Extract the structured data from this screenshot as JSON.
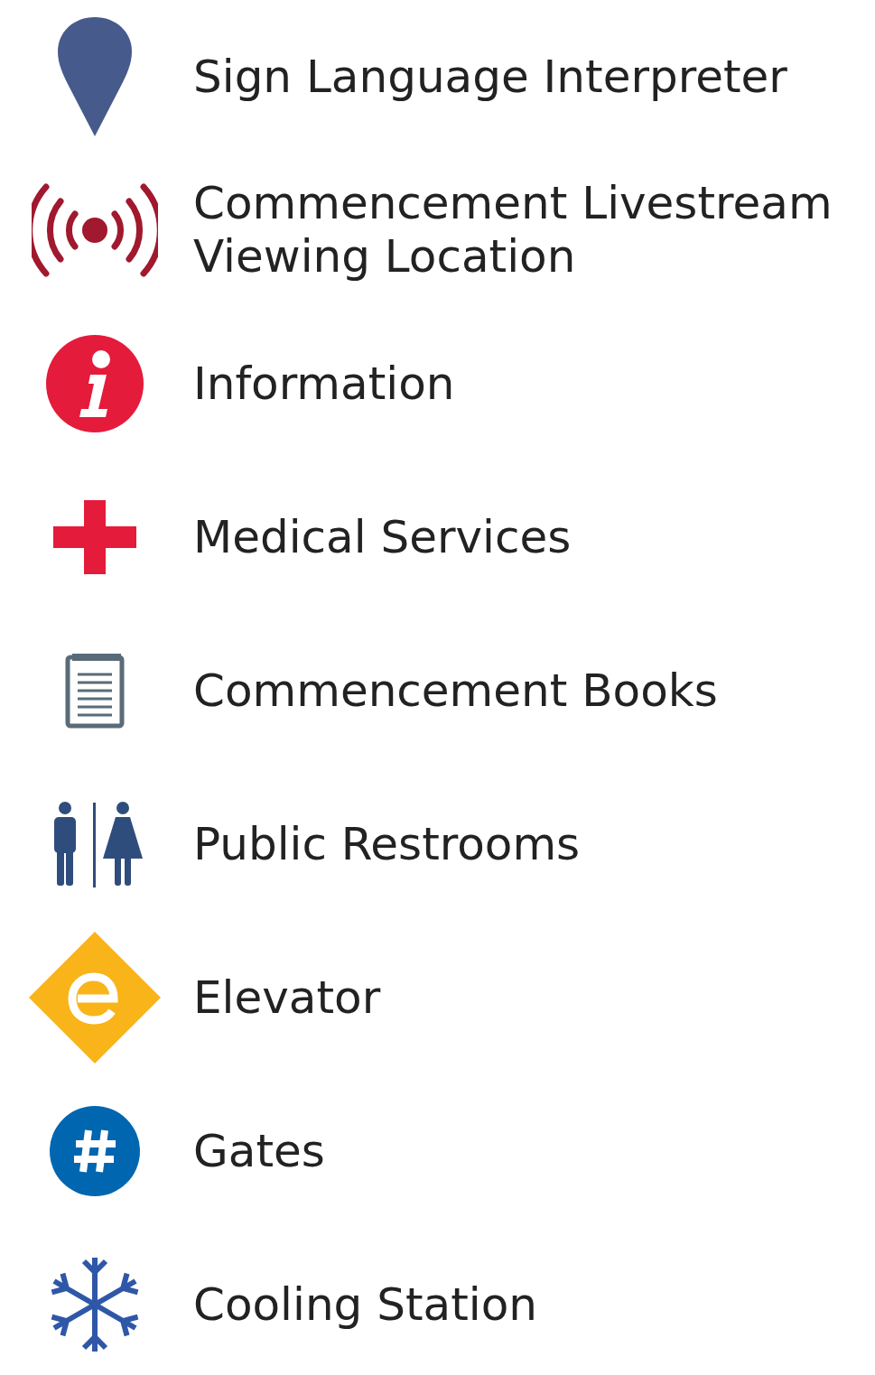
{
  "legend": {
    "items": [
      {
        "kind": "pin",
        "label": "Sign Language Interpreter"
      },
      {
        "kind": "broadcast",
        "label": "Commencement Livestream Viewing Location"
      },
      {
        "kind": "info",
        "label": "Information"
      },
      {
        "kind": "cross",
        "label": "Medical Services"
      },
      {
        "kind": "book",
        "label": "Commencement Books"
      },
      {
        "kind": "restroom",
        "label": "Public Restrooms"
      },
      {
        "kind": "elevator",
        "label": "Elevator"
      },
      {
        "kind": "gate",
        "label": "Gates"
      },
      {
        "kind": "snowflake",
        "label": "Cooling Station"
      }
    ]
  }
}
